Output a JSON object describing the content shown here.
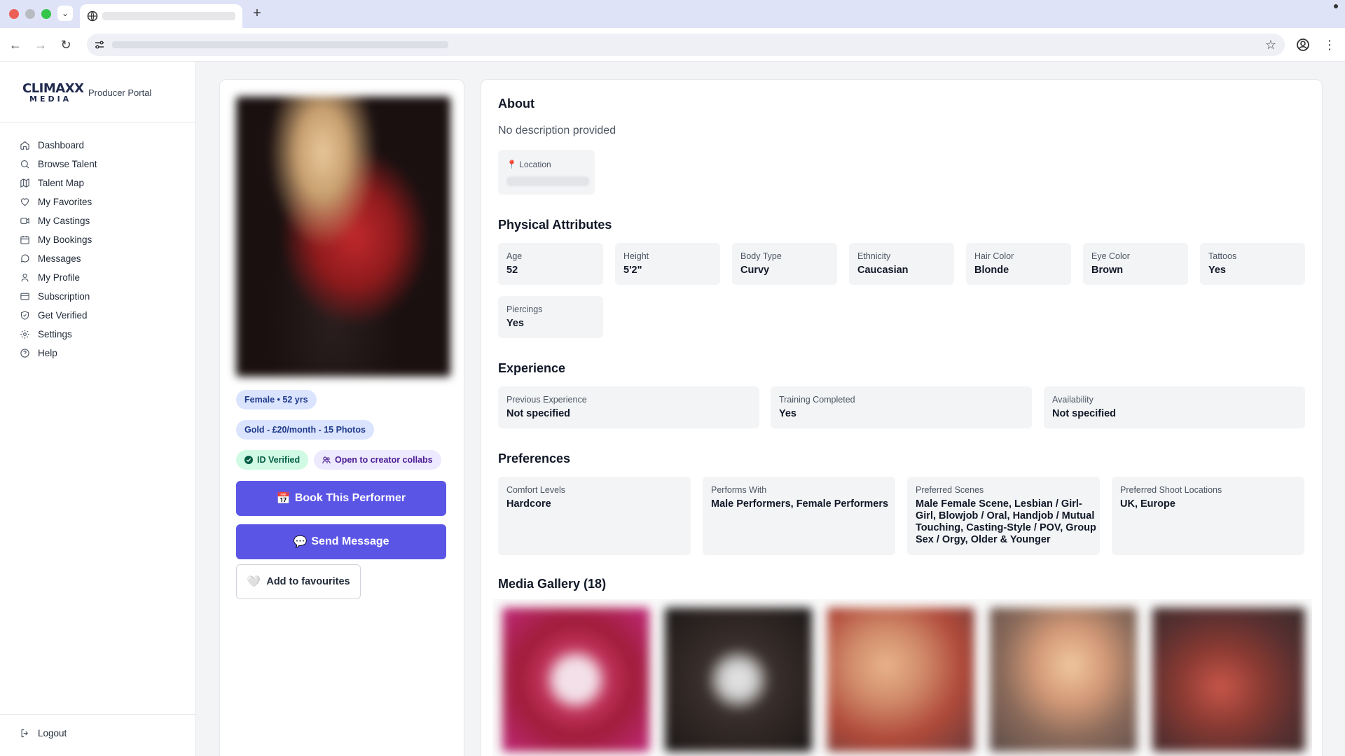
{
  "browser": {
    "tab_title": "",
    "url": ""
  },
  "sidebar": {
    "brand_line1": "CLIMAXX",
    "brand_line2": "MEDIA",
    "portal_label": "Producer Portal",
    "items": [
      {
        "label": "Dashboard",
        "icon": "home-icon"
      },
      {
        "label": "Browse Talent",
        "icon": "search-icon"
      },
      {
        "label": "Talent Map",
        "icon": "map-icon"
      },
      {
        "label": "My Favorites",
        "icon": "heart-icon"
      },
      {
        "label": "My Castings",
        "icon": "video-icon"
      },
      {
        "label": "My Bookings",
        "icon": "calendar-icon"
      },
      {
        "label": "Messages",
        "icon": "message-icon"
      },
      {
        "label": "My Profile",
        "icon": "user-icon"
      },
      {
        "label": "Subscription",
        "icon": "card-icon"
      },
      {
        "label": "Get Verified",
        "icon": "shield-icon"
      },
      {
        "label": "Settings",
        "icon": "gear-icon"
      },
      {
        "label": "Help",
        "icon": "help-icon"
      }
    ],
    "logout_label": "Logout"
  },
  "profile": {
    "gender_age": "Female • 52 yrs",
    "tier": "Gold - £20/month - 15 Photos",
    "verified": "ID Verified",
    "collab": "Open to creator collabs",
    "book_button": "Book This Performer",
    "book_emoji": "📅",
    "message_button": "Send Message",
    "message_emoji": "💬",
    "favourite_button": "Add to favourites",
    "favourite_emoji": "🤍",
    "accent_color": "#5b55e6"
  },
  "about": {
    "heading": "About",
    "description": "No description provided",
    "location_label": "Location",
    "location_emoji": "📍"
  },
  "physical": {
    "heading": "Physical Attributes",
    "attrs": [
      {
        "label": "Age",
        "value": "52"
      },
      {
        "label": "Height",
        "value": "5'2\""
      },
      {
        "label": "Body Type",
        "value": "Curvy"
      },
      {
        "label": "Ethnicity",
        "value": "Caucasian"
      },
      {
        "label": "Hair Color",
        "value": "Blonde"
      },
      {
        "label": "Eye Color",
        "value": "Brown"
      },
      {
        "label": "Tattoos",
        "value": "Yes"
      },
      {
        "label": "Piercings",
        "value": "Yes"
      }
    ]
  },
  "experience": {
    "heading": "Experience",
    "items": [
      {
        "label": "Previous Experience",
        "value": "Not specified"
      },
      {
        "label": "Training Completed",
        "value": "Yes"
      },
      {
        "label": "Availability",
        "value": "Not specified"
      }
    ]
  },
  "preferences": {
    "heading": "Preferences",
    "items": [
      {
        "label": "Comfort Levels",
        "value": "Hardcore"
      },
      {
        "label": "Performs With",
        "value": "Male Performers, Female Performers"
      },
      {
        "label": "Preferred Scenes",
        "value": "Male Female Scene, Lesbian / Girl-Girl, Blowjob / Oral, Handjob / Mutual Touching, Casting-Style / POV, Group Sex / Orgy, Older & Younger"
      },
      {
        "label": "Preferred Shoot Locations",
        "value": "UK, Europe"
      }
    ]
  },
  "gallery": {
    "heading": "Media Gallery (18)"
  }
}
